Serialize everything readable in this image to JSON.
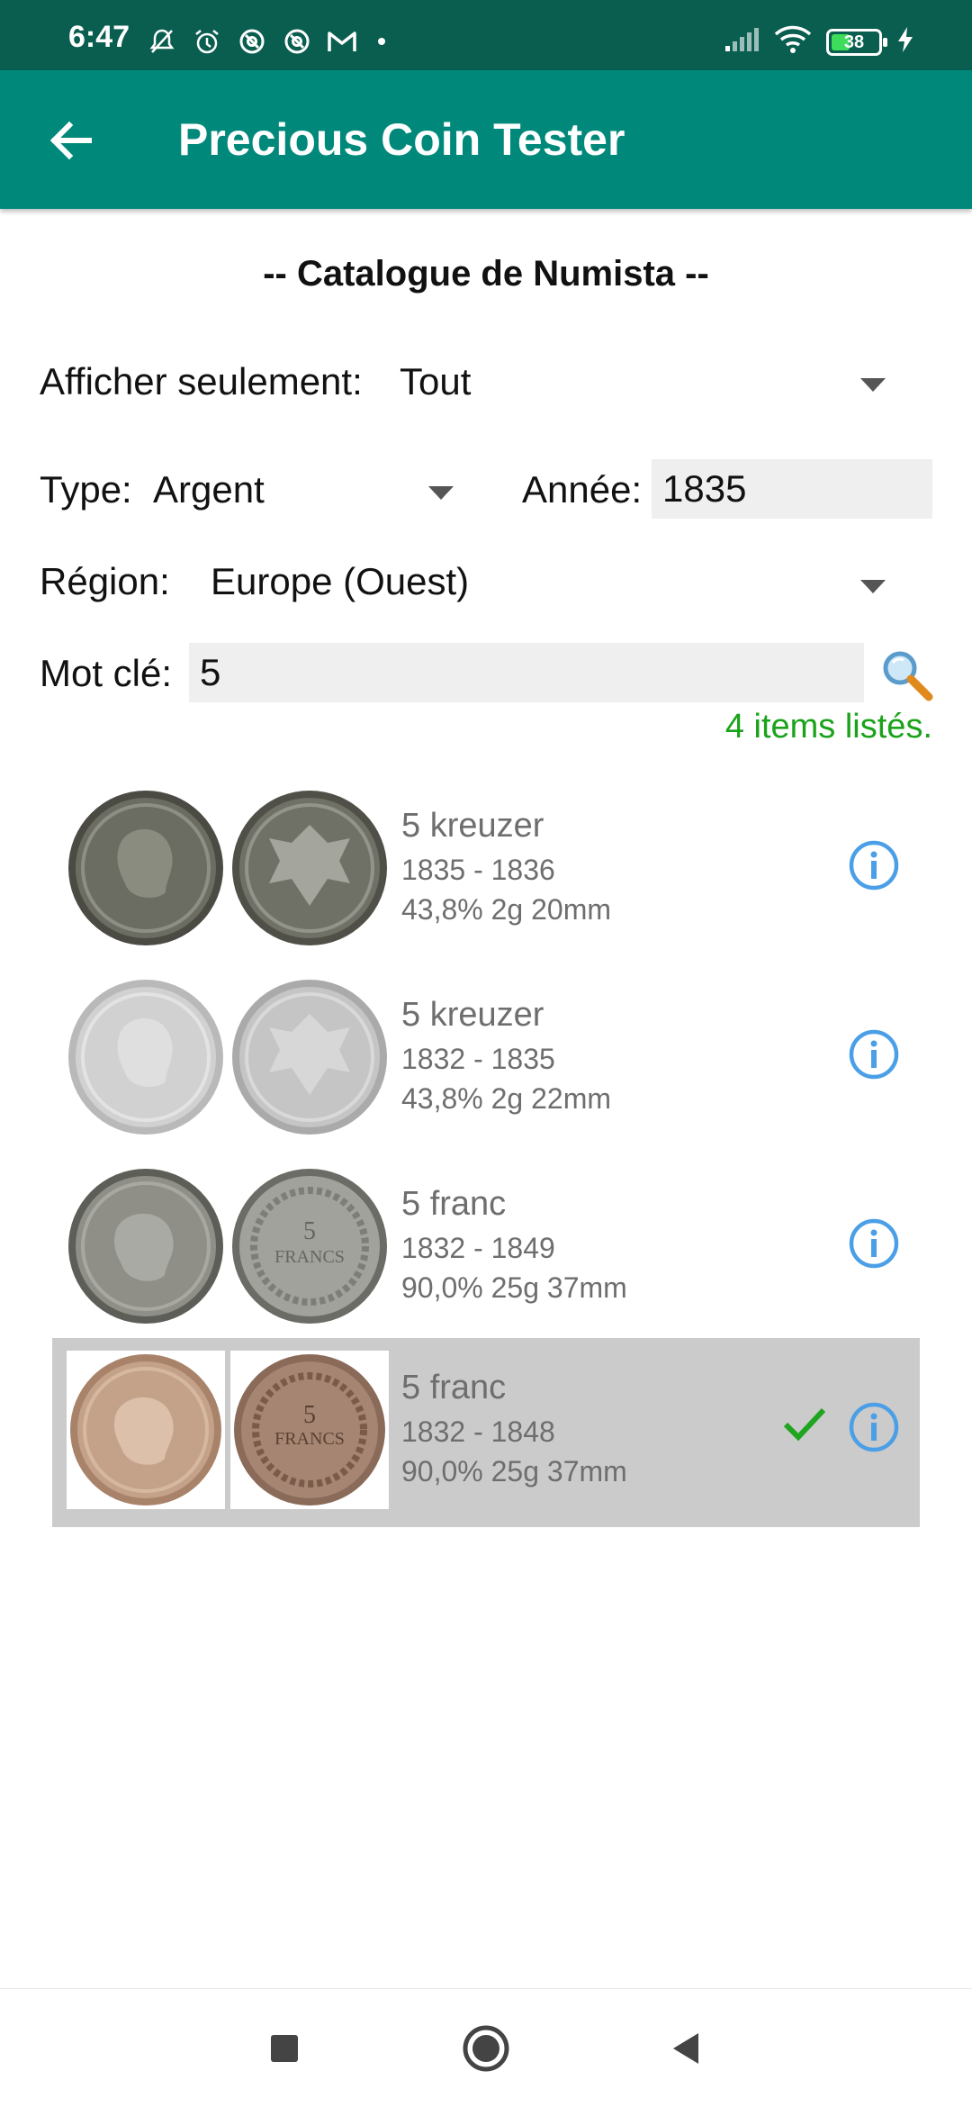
{
  "status_bar": {
    "time": "6:47",
    "left_icons": [
      "mute-bell-icon",
      "alarm-icon",
      "at-sign-icon",
      "at-sign-icon",
      "gmail-icon"
    ],
    "right_icons": [
      "signal-icon",
      "wifi-icon",
      "battery-icon",
      "charging-icon"
    ],
    "battery_level": "38"
  },
  "app_bar": {
    "title": "Precious Coin Tester",
    "background": "#00897b"
  },
  "catalog_title": "-- Catalogue de Numista --",
  "filters": {
    "show_only_label": "Afficher seulement:",
    "show_only_value": "Tout",
    "type_label": "Type:",
    "type_value": "Argent",
    "year_label": "Année:",
    "year_value": "1835",
    "region_label": "Région:",
    "region_value": "Europe (Ouest)",
    "keyword_label": "Mot clé:",
    "keyword_value": "5"
  },
  "items_count": "4 items listés.",
  "coins": [
    {
      "name": "5 kreuzer",
      "years": "1835 - 1836",
      "specs": "43,8% 2g 20mm",
      "selected": false,
      "obverse_tone": "dark-silver",
      "reverse_tone": "dark-silver"
    },
    {
      "name": "5 kreuzer",
      "years": "1832 - 1835",
      "specs": "43,8% 2g 22mm",
      "selected": false,
      "obverse_tone": "light-silver",
      "reverse_tone": "light-silver"
    },
    {
      "name": "5 franc",
      "years": "1832 - 1849",
      "specs": "90,0% 25g 37mm",
      "selected": false,
      "obverse_tone": "silver",
      "reverse_tone": "silver"
    },
    {
      "name": "5 franc",
      "years": "1832 - 1848",
      "specs": "90,0% 25g 37mm",
      "selected": true,
      "obverse_tone": "copper",
      "reverse_tone": "copper"
    }
  ],
  "colors": {
    "status_bar": "#0a5e4f",
    "accent": "#00897b",
    "count_text": "#1aa31a",
    "info_blue": "#4a9fe6",
    "check_green": "#1fa51f",
    "selected_row": "#cbcbcb"
  },
  "nav_bar": {
    "buttons": [
      "recents-square-icon",
      "home-circle-icon",
      "back-triangle-icon"
    ]
  }
}
